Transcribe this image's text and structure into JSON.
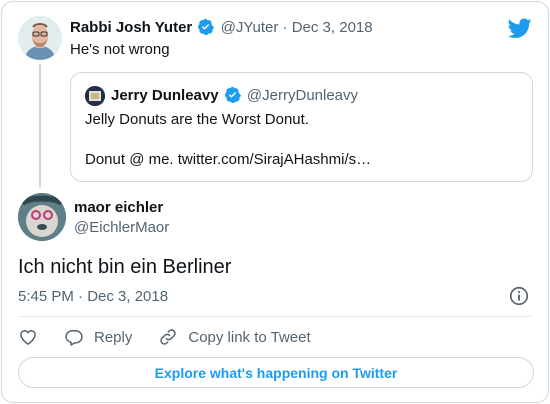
{
  "parent_tweet": {
    "name": "Rabbi Josh Yuter",
    "handle": "@JYuter",
    "separator": "·",
    "date": "Dec 3, 2018",
    "text": "He's not wrong"
  },
  "quoted_tweet": {
    "name": "Jerry Dunleavy",
    "handle": "@JerryDunleavy",
    "line1": "Jelly Donuts are the Worst Donut.",
    "line2": "Donut @ me. twitter.com/SirajAHashmi/s…"
  },
  "main_tweet": {
    "name": "maor eichler",
    "handle": "@EichlerMaor",
    "text": "Ich nicht bin ein Berliner",
    "timestamp": "5:45 PM · Dec 3, 2018"
  },
  "actions": {
    "reply_label": "Reply",
    "copy_label": "Copy link to Tweet"
  },
  "explore_label": "Explore what's happening on Twitter",
  "colors": {
    "accent": "#1d9bf0",
    "text_secondary": "#536471",
    "border": "#cfd9de"
  },
  "icons": [
    "twitter-bird-icon",
    "verified-badge-icon",
    "info-icon",
    "heart-icon",
    "reply-icon",
    "link-icon"
  ]
}
